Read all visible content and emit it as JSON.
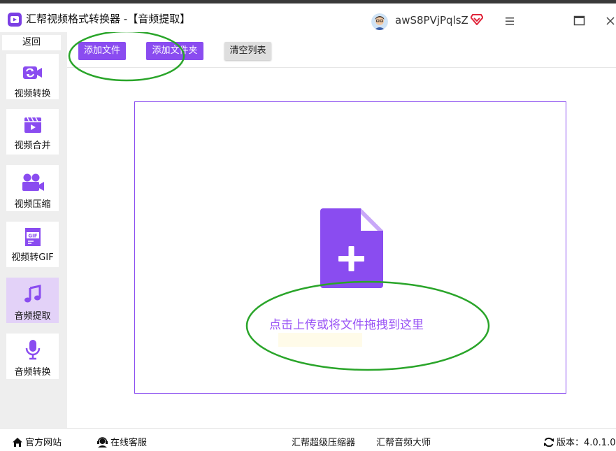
{
  "app": {
    "title": "汇帮视频格式转换器",
    "subtitle": " -【音频提取】",
    "username": "awS8PVjPqlsZ"
  },
  "sidebar": {
    "back_label": "返回",
    "items": [
      {
        "label": "视频转换",
        "icon": "video-convert-icon",
        "active": false
      },
      {
        "label": "视频合并",
        "icon": "video-merge-icon",
        "active": false
      },
      {
        "label": "视频压缩",
        "icon": "video-compress-icon",
        "active": false
      },
      {
        "label": "视频转GIF",
        "icon": "gif-icon",
        "active": false
      },
      {
        "label": "音频提取",
        "icon": "music-note-icon",
        "active": true
      },
      {
        "label": "音频转换",
        "icon": "microphone-icon",
        "active": false
      }
    ]
  },
  "toolbar": {
    "add_file_label": "添加文件",
    "add_folder_label": "添加文件夹",
    "clear_list_label": "清空列表"
  },
  "dropzone": {
    "hint": "点击上传或将文件拖拽到这里"
  },
  "footer": {
    "website_label": "官方网站",
    "support_label": "在线客服",
    "compressor_label": "汇帮超级压缩器",
    "audio_master_label": "汇帮音频大师",
    "version_label": "版本：4.0.1.0"
  },
  "colors": {
    "accent": "#8a4cf0",
    "active_nav_bg": "#e3d2f8",
    "annotation": "#2aa52a"
  }
}
